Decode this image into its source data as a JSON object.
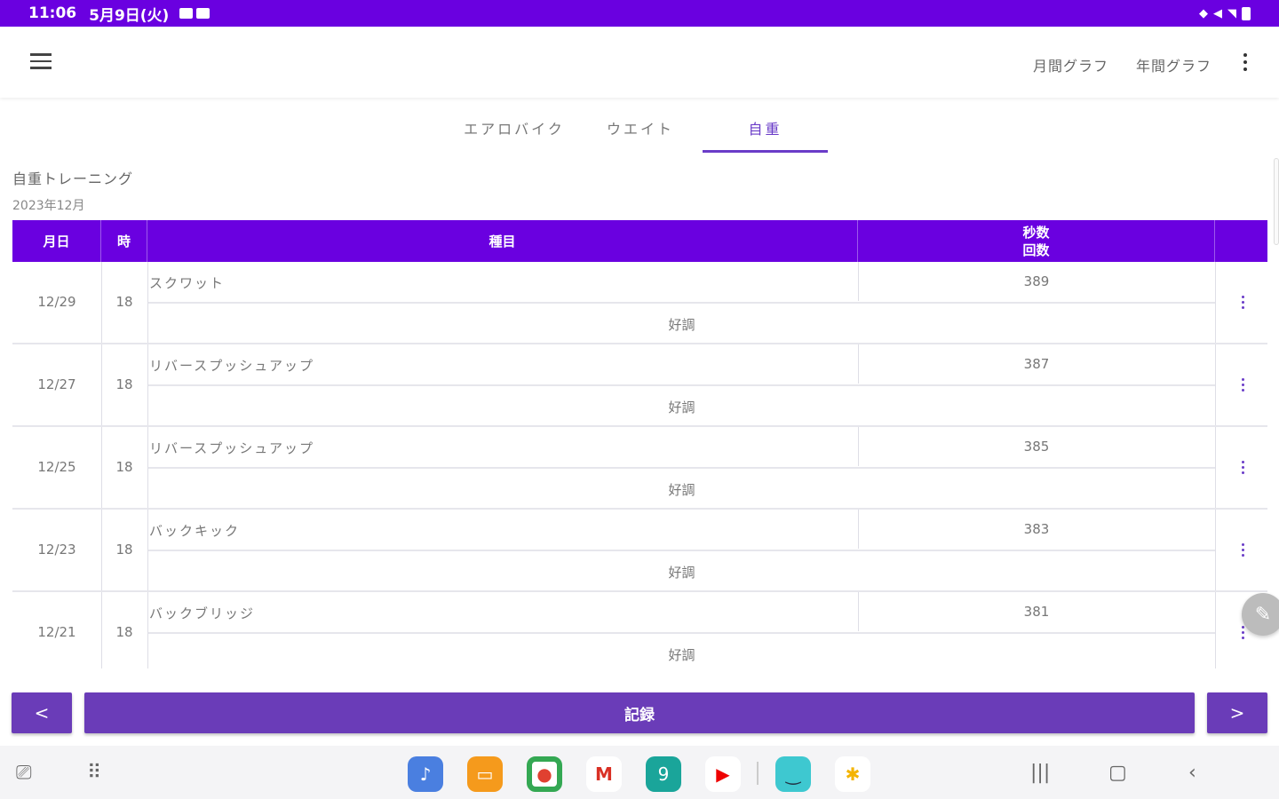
{
  "status_bar": {
    "time": "11:06",
    "date": "5月9日(火)",
    "right_icons": [
      "volume-icon",
      "signal-icon",
      "wifi-icon",
      "battery-icon"
    ]
  },
  "app_bar": {
    "menu_icon": "hamburger-icon",
    "monthly_graph": "月間グラフ",
    "yearly_graph": "年間グラフ",
    "overflow_icon": "more-vert-icon"
  },
  "tabs": [
    {
      "label": "エアロバイク",
      "selected": false
    },
    {
      "label": "ウエイト",
      "selected": false
    },
    {
      "label": "自重",
      "selected": true
    }
  ],
  "section": {
    "title": "自重トレーニング",
    "period": "2023年12月"
  },
  "table": {
    "headers": {
      "date": "月日",
      "hour": "時",
      "item": "種目",
      "count_line1": "秒数",
      "count_line2": "回数"
    },
    "rows": [
      {
        "date": "12/29",
        "hour": "18",
        "item": "スクワット",
        "count": "389",
        "condition": "好調"
      },
      {
        "date": "12/27",
        "hour": "18",
        "item": "リバースプッシュアップ",
        "count": "387",
        "condition": "好調"
      },
      {
        "date": "12/25",
        "hour": "18",
        "item": "リバースプッシュアップ",
        "count": "385",
        "condition": "好調"
      },
      {
        "date": "12/23",
        "hour": "18",
        "item": "バックキック",
        "count": "383",
        "condition": "好調"
      },
      {
        "date": "12/21",
        "hour": "18",
        "item": "バックブリッジ",
        "count": "381",
        "condition": "好調"
      }
    ]
  },
  "buttons": {
    "prev": "<",
    "record": "記録",
    "next": ">"
  },
  "colors": {
    "status_bar": "#6a00e0",
    "table_header": "#6a00e0",
    "button": "#6a3cb8",
    "tab_accent": "#6a3cc8"
  },
  "nav_apps": [
    "music-icon",
    "files-icon",
    "chrome-icon",
    "gmail-icon",
    "calendar-icon",
    "youtube-icon",
    "amazon-icon",
    "photos-icon"
  ]
}
